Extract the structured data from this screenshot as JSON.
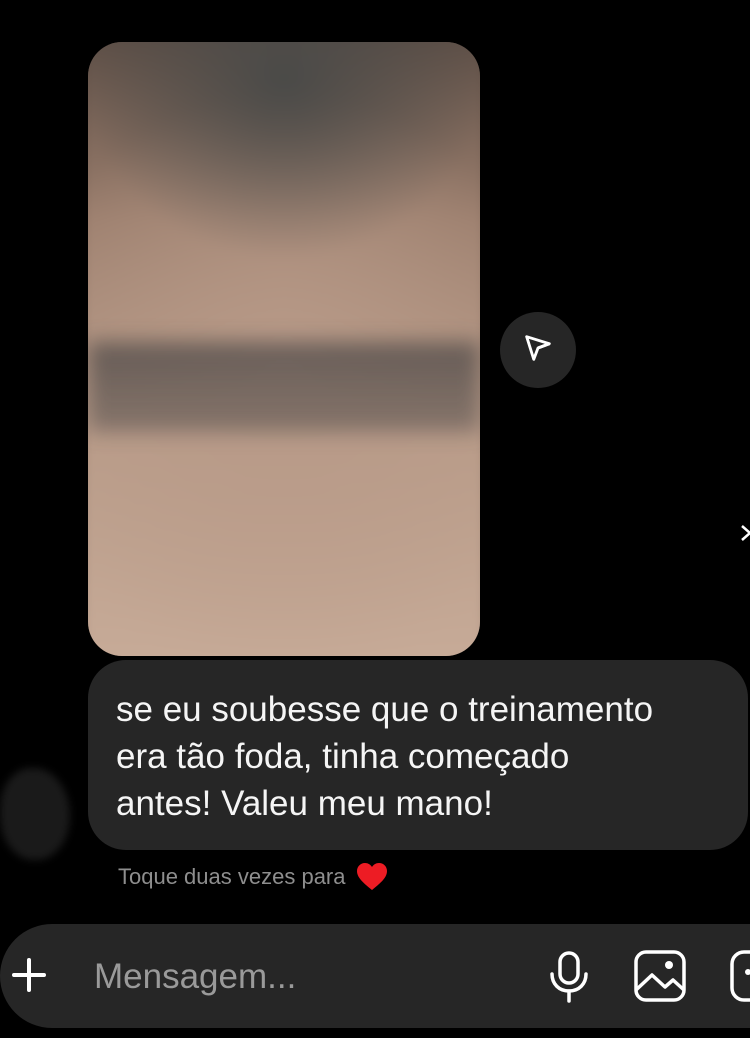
{
  "thread": {
    "media_message": {
      "icon": "image-attachment",
      "share_icon": "paper-plane-icon"
    },
    "text_message": {
      "lines": [
        "se eu soubesse que o treinamento",
        "era tão foda, tinha começado",
        "antes! Valeu meu mano!"
      ]
    },
    "hint": {
      "text": "Toque duas vezes para",
      "icon": "heart-icon",
      "heart_color": "#ed1c24"
    }
  },
  "composer": {
    "placeholder": "Mensagem...",
    "icons": [
      "plus-icon",
      "microphone-icon",
      "gallery-icon",
      "sticker-icon"
    ]
  },
  "colors": {
    "background": "#000000",
    "bubble": "#262626",
    "hint_text": "#8e8e8e"
  }
}
